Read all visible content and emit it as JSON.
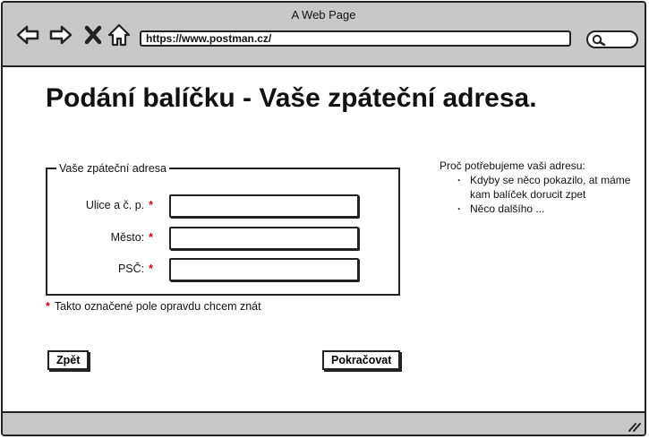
{
  "window": {
    "title": "A Web Page"
  },
  "browser": {
    "url": "https://www.postman.cz/"
  },
  "page": {
    "heading": "Podání balíčku - Vaše zpáteční adresa.",
    "form": {
      "legend": "Vaše zpáteční adresa",
      "fields": [
        {
          "label": "Ulice a č. p.",
          "required_mark": "*",
          "value": ""
        },
        {
          "label": "Město:",
          "required_mark": "*",
          "value": ""
        },
        {
          "label": "PSČ:",
          "required_mark": "*",
          "value": ""
        }
      ]
    },
    "footnote": {
      "mark": "*",
      "text": "Takto označené pole opravdu chcem znát"
    },
    "buttons": {
      "back": "Zpět",
      "next": "Pokračovat"
    },
    "info": {
      "title": "Proč potřebujeme vaši adresu:",
      "items": [
        "Kdyby se něco pokazilo, at máme kam balíček dorucit zpet",
        "Něco dalšího ..."
      ]
    }
  },
  "icons": [
    "back-arrow-icon",
    "forward-arrow-icon",
    "close-icon",
    "home-icon",
    "search-icon",
    "resize-grip-icon"
  ],
  "colors": {
    "chrome": "#c8c8c8",
    "required": "#d0021b",
    "border": "#222222"
  }
}
